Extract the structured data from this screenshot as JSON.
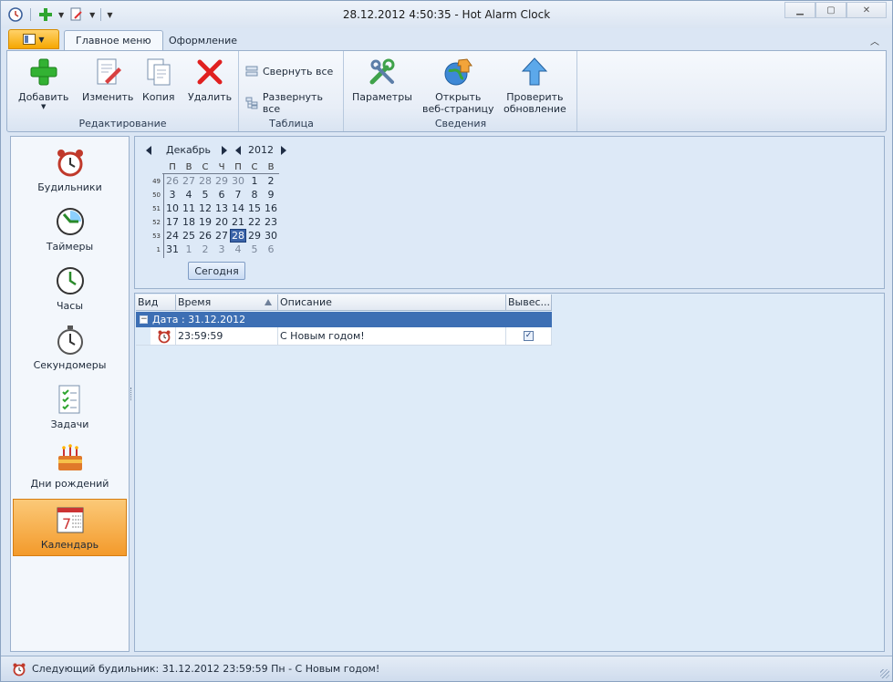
{
  "window": {
    "title": "28.12.2012 4:50:35 - Hot Alarm Clock"
  },
  "ribbon": {
    "tabs": [
      {
        "label": "Главное меню"
      },
      {
        "label": "Оформление"
      }
    ],
    "groups": {
      "edit": {
        "label": "Редактирование",
        "buttons": [
          {
            "label": "Добавить",
            "icon": "plus-icon"
          },
          {
            "label": "Изменить",
            "icon": "edit-document-icon"
          },
          {
            "label": "Копия",
            "icon": "copy-icon"
          },
          {
            "label": "Удалить",
            "icon": "delete-x-icon"
          }
        ]
      },
      "table": {
        "label": "Таблица",
        "buttons": [
          {
            "label": "Свернуть все",
            "icon": "collapse-all-icon"
          },
          {
            "label": "Развернуть все",
            "icon": "expand-all-icon"
          }
        ]
      },
      "info": {
        "label": "Сведения",
        "buttons": [
          {
            "label": "Параметры",
            "icon": "tools-icon"
          },
          {
            "line1": "Открыть",
            "line2": "веб-страницу",
            "icon": "globe-home-icon"
          },
          {
            "line1": "Проверить",
            "line2": "обновление",
            "icon": "update-arrow-icon"
          }
        ]
      }
    }
  },
  "nav": {
    "items": [
      {
        "label": "Будильники",
        "icon": "alarm-clock-icon"
      },
      {
        "label": "Таймеры",
        "icon": "timer-icon"
      },
      {
        "label": "Часы",
        "icon": "clock-icon"
      },
      {
        "label": "Секундомеры",
        "icon": "stopwatch-icon"
      },
      {
        "label": "Задачи",
        "icon": "tasks-checklist-icon"
      },
      {
        "label": "Дни рождений",
        "icon": "birthday-cake-icon"
      },
      {
        "label": "Календарь",
        "icon": "calendar-icon",
        "selected": true
      }
    ]
  },
  "calendar": {
    "month": "Декабрь",
    "year": "2012",
    "weekdays": [
      "П",
      "В",
      "С",
      "Ч",
      "П",
      "С",
      "В"
    ],
    "weeks": [
      {
        "num": "49",
        "days": [
          "26",
          "27",
          "28",
          "29",
          "30",
          "1",
          "2"
        ]
      },
      {
        "num": "50",
        "days": [
          "3",
          "4",
          "5",
          "6",
          "7",
          "8",
          "9"
        ]
      },
      {
        "num": "51",
        "days": [
          "10",
          "11",
          "12",
          "13",
          "14",
          "15",
          "16"
        ]
      },
      {
        "num": "52",
        "days": [
          "17",
          "18",
          "19",
          "20",
          "21",
          "22",
          "23"
        ]
      },
      {
        "num": "53",
        "days": [
          "24",
          "25",
          "26",
          "27",
          "28",
          "29",
          "30"
        ]
      },
      {
        "num": "1",
        "days": [
          "31",
          "1",
          "2",
          "3",
          "4",
          "5",
          "6"
        ]
      }
    ],
    "selected_day": "28",
    "today_button": "Сегодня"
  },
  "grid": {
    "columns": [
      "Вид",
      "Время",
      "Описание",
      "Вывес..."
    ],
    "group_label": "Дата : 31.12.2012",
    "rows": [
      {
        "icon": "alarm-clock-icon",
        "time": "23:59:59",
        "description": "С Новым годом!",
        "checked": true
      }
    ]
  },
  "status": {
    "text": "Следующий будильник: 31.12.2012 23:59:59 Пн - С Новым годом!"
  },
  "colors": {
    "accent": "#3d6fb4",
    "app_button": "#f6a700",
    "selected_nav": "#f39a2b"
  }
}
